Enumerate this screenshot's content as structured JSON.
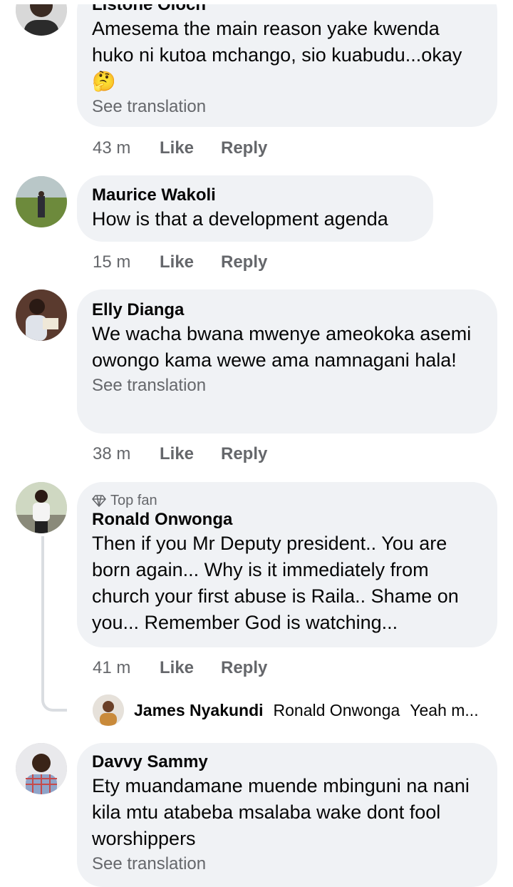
{
  "comments": [
    {
      "author": "Listone Oloch",
      "text": "Amesema the main reason yake kwenda huko ni kutoa mchango, sio kuabudu...okay🤔",
      "see_translation": "See translation",
      "time": "43 m",
      "like": "Like",
      "reply": "Reply"
    },
    {
      "author": "Maurice Wakoli",
      "text": "How is that a development agenda",
      "time": "15 m",
      "like": "Like",
      "reply": "Reply"
    },
    {
      "author": "Elly Dianga",
      "text": "We wacha bwana mwenye ameokoka asemi owongo kama wewe ama namnagani hala!",
      "see_translation": "See translation",
      "time": "38 m",
      "like": "Like",
      "reply": "Reply"
    },
    {
      "badge": "Top fan",
      "author": "Ronald Onwonga",
      "text": "Then if you Mr Deputy president.. You are born again... Why is it immediately from church your first abuse is Raila.. Shame on you... Remember God is watching...",
      "time": "41 m",
      "like": "Like",
      "reply": "Reply"
    },
    {
      "author": "Davvy Sammy",
      "text": "Ety muandamane muende mbinguni na nani kila mtu atabeba msalaba wake dont fool worshippers",
      "see_translation": "See translation"
    }
  ],
  "reply_preview": {
    "author": "James Nyakundi",
    "mention": "Ronald Onwonga",
    "snippet": "Yeah m..."
  },
  "icons": {
    "badge": "diamond-icon"
  },
  "colors": {
    "bubble": "#f0f2f5",
    "secondary_text": "#65676b",
    "primary_text": "#050505",
    "thread_line": "#dadde1"
  }
}
